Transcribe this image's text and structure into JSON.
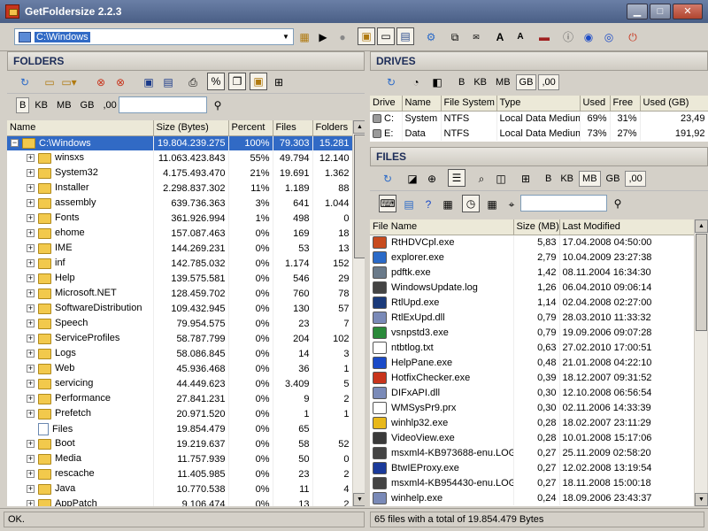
{
  "title": "GetFoldersize 2.2.3",
  "path": "C:\\Windows",
  "folders_panel": {
    "title": "FOLDERS",
    "unit_buttons": [
      "B",
      "KB",
      "MB",
      "GB",
      ",00"
    ],
    "columns": [
      "Name",
      "Size (Bytes)",
      "Percent",
      "Files",
      "Folders"
    ],
    "rows": [
      {
        "name": "C:\\Windows",
        "size": "19.804.239.275",
        "percent": "100%",
        "files": "79.303",
        "folders": "15.281"
      },
      {
        "name": "winsxs",
        "size": "11.063.423.843",
        "percent": "55%",
        "files": "49.794",
        "folders": "12.140"
      },
      {
        "name": "System32",
        "size": "4.175.493.470",
        "percent": "21%",
        "files": "19.691",
        "folders": "1.362"
      },
      {
        "name": "Installer",
        "size": "2.298.837.302",
        "percent": "11%",
        "files": "1.189",
        "folders": "88"
      },
      {
        "name": "assembly",
        "size": "639.736.363",
        "percent": "3%",
        "files": "641",
        "folders": "1.044"
      },
      {
        "name": "Fonts",
        "size": "361.926.994",
        "percent": "1%",
        "files": "498",
        "folders": "0"
      },
      {
        "name": "ehome",
        "size": "157.087.463",
        "percent": "0%",
        "files": "169",
        "folders": "18"
      },
      {
        "name": "IME",
        "size": "144.269.231",
        "percent": "0%",
        "files": "53",
        "folders": "13"
      },
      {
        "name": "inf",
        "size": "142.785.032",
        "percent": "0%",
        "files": "1.174",
        "folders": "152"
      },
      {
        "name": "Help",
        "size": "139.575.581",
        "percent": "0%",
        "files": "546",
        "folders": "29"
      },
      {
        "name": "Microsoft.NET",
        "size": "128.459.702",
        "percent": "0%",
        "files": "760",
        "folders": "78"
      },
      {
        "name": "SoftwareDistribution",
        "size": "109.432.945",
        "percent": "0%",
        "files": "130",
        "folders": "57"
      },
      {
        "name": "Speech",
        "size": "79.954.575",
        "percent": "0%",
        "files": "23",
        "folders": "7"
      },
      {
        "name": "ServiceProfiles",
        "size": "58.787.799",
        "percent": "0%",
        "files": "204",
        "folders": "102"
      },
      {
        "name": "Logs",
        "size": "58.086.845",
        "percent": "0%",
        "files": "14",
        "folders": "3"
      },
      {
        "name": "Web",
        "size": "45.936.468",
        "percent": "0%",
        "files": "36",
        "folders": "1"
      },
      {
        "name": "servicing",
        "size": "44.449.623",
        "percent": "0%",
        "files": "3.409",
        "folders": "5"
      },
      {
        "name": "Performance",
        "size": "27.841.231",
        "percent": "0%",
        "files": "9",
        "folders": "2"
      },
      {
        "name": "Prefetch",
        "size": "20.971.520",
        "percent": "0%",
        "files": "1",
        "folders": "1"
      },
      {
        "name": "Files",
        "size": "19.854.479",
        "percent": "0%",
        "files": "65",
        "folders": ""
      },
      {
        "name": "Boot",
        "size": "19.219.637",
        "percent": "0%",
        "files": "58",
        "folders": "52"
      },
      {
        "name": "Media",
        "size": "11.757.939",
        "percent": "0%",
        "files": "50",
        "folders": "0"
      },
      {
        "name": "rescache",
        "size": "11.405.985",
        "percent": "0%",
        "files": "23",
        "folders": "2"
      },
      {
        "name": "Java",
        "size": "10.770.538",
        "percent": "0%",
        "files": "11",
        "folders": "4"
      },
      {
        "name": "AppPatch",
        "size": "9.106.474",
        "percent": "0%",
        "files": "13",
        "folders": "2"
      }
    ]
  },
  "drives_panel": {
    "title": "DRIVES",
    "unit_buttons": [
      "B",
      "KB",
      "MB",
      "GB",
      ",00"
    ],
    "columns": [
      "Drive",
      "Name",
      "File System",
      "Type",
      "Used",
      "Free",
      "Used (GB)"
    ],
    "rows": [
      {
        "drive": "C:",
        "name": "System",
        "fs": "NTFS",
        "type": "Local Data Medium",
        "used": "69%",
        "free": "31%",
        "usedgb": "23,49"
      },
      {
        "drive": "E:",
        "name": "Data",
        "fs": "NTFS",
        "type": "Local Data Medium",
        "used": "73%",
        "free": "27%",
        "usedgb": "191,92"
      }
    ]
  },
  "files_panel": {
    "title": "FILES",
    "unit_buttons": [
      "B",
      "KB",
      "MB",
      "GB",
      ",00"
    ],
    "columns": [
      "File Name",
      "Size (MB)",
      "Last Modified"
    ],
    "rows": [
      {
        "name": "RtHDVCpl.exe",
        "size": "5,83",
        "modified": "17.04.2008 04:50:00",
        "color": "#c84b1e"
      },
      {
        "name": "explorer.exe",
        "size": "2,79",
        "modified": "10.04.2009 23:27:38",
        "color": "#2a6ac8"
      },
      {
        "name": "pdftk.exe",
        "size": "1,42",
        "modified": "08.11.2004 16:34:30",
        "color": "#6a7a8a"
      },
      {
        "name": "WindowsUpdate.log",
        "size": "1,26",
        "modified": "06.04.2010 09:06:14",
        "color": "#444444"
      },
      {
        "name": "RtlUpd.exe",
        "size": "1,14",
        "modified": "02.04.2008 02:27:00",
        "color": "#1a3a7a"
      },
      {
        "name": "RtlExUpd.dll",
        "size": "0,79",
        "modified": "28.03.2010 11:33:32",
        "color": "#7a8ab8"
      },
      {
        "name": "vsnpstd3.exe",
        "size": "0,79",
        "modified": "19.09.2006 09:07:28",
        "color": "#2a8a3a"
      },
      {
        "name": "ntbtlog.txt",
        "size": "0,63",
        "modified": "27.02.2010 17:00:51",
        "color": "#ffffff"
      },
      {
        "name": "HelpPane.exe",
        "size": "0,48",
        "modified": "21.01.2008 04:22:10",
        "color": "#1a4ac8"
      },
      {
        "name": "HotfixChecker.exe",
        "size": "0,39",
        "modified": "18.12.2007 09:31:52",
        "color": "#c8341c"
      },
      {
        "name": "DIFxAPI.dll",
        "size": "0,30",
        "modified": "12.10.2008 06:56:54",
        "color": "#7a8ab8"
      },
      {
        "name": "WMSysPr9.prx",
        "size": "0,30",
        "modified": "02.11.2006 14:33:39",
        "color": "#ffffff"
      },
      {
        "name": "winhlp32.exe",
        "size": "0,28",
        "modified": "18.02.2007 23:11:29",
        "color": "#e8b81a"
      },
      {
        "name": "VideoView.exe",
        "size": "0,28",
        "modified": "10.01.2008 15:17:06",
        "color": "#3a3a3a"
      },
      {
        "name": "msxml4-KB973688-enu.LOG",
        "size": "0,27",
        "modified": "25.11.2009 02:58:20",
        "color": "#444444"
      },
      {
        "name": "BtwIEProxy.exe",
        "size": "0,27",
        "modified": "12.02.2008 13:19:54",
        "color": "#1a3a9a"
      },
      {
        "name": "msxml4-KB954430-enu.LOG",
        "size": "0,27",
        "modified": "18.11.2008 15:00:18",
        "color": "#444444"
      },
      {
        "name": "winhelp.exe",
        "size": "0,24",
        "modified": "18.09.2006 23:43:37",
        "color": "#7a8ab8"
      }
    ]
  },
  "status": {
    "left": "OK.",
    "right": "65 files with a total of 19.854.479 Bytes"
  }
}
